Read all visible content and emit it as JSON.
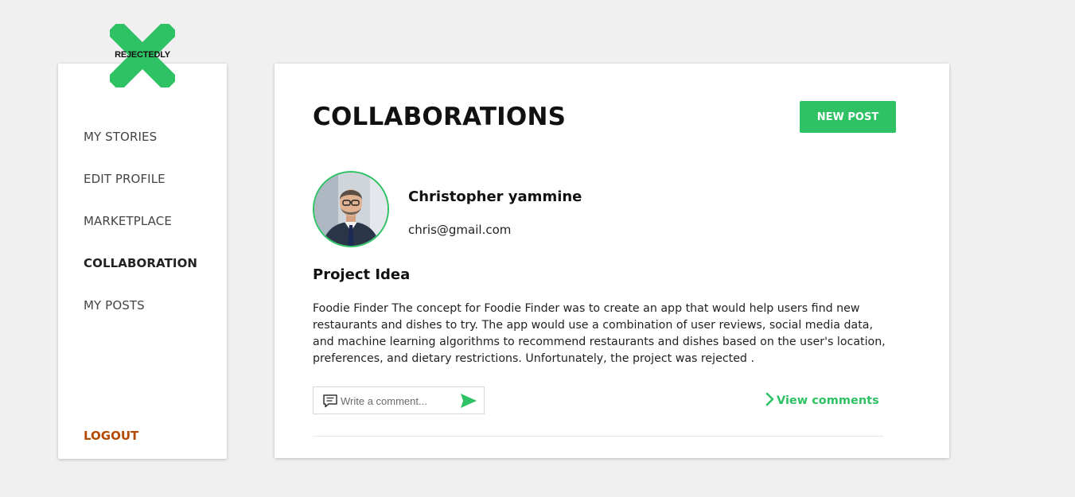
{
  "brand": {
    "name": "REJECTEDLY",
    "accent_color": "#2ec264"
  },
  "sidebar": {
    "items": [
      {
        "label": "MY STORIES",
        "active": false
      },
      {
        "label": "EDIT PROFILE",
        "active": false
      },
      {
        "label": "MARKETPLACE",
        "active": false
      },
      {
        "label": "COLLABORATION",
        "active": true
      },
      {
        "label": "MY POSTS",
        "active": false
      }
    ],
    "logout_label": "LOGOUT",
    "logout_color": "#b34a00"
  },
  "main": {
    "title": "COLLABORATIONS",
    "new_post_label": "NEW POST",
    "post": {
      "author_name": "Christopher yammine",
      "author_email": "chris@gmail.com",
      "title": "Project Idea",
      "body": "Foodie Finder The concept for Foodie Finder was to create an app that would help users find new restaurants and dishes to try. The app would use a combination of user reviews, social media data, and machine learning algorithms to recommend restaurants and dishes based on the user's location, preferences, and dietary restrictions. Unfortunately, the project was rejected .",
      "comment_placeholder": "Write a comment...",
      "view_comments_label": "View comments"
    }
  },
  "icons": {
    "logo": "x-mark-logo-icon",
    "avatar": "user-avatar",
    "comment": "comment-icon",
    "send": "send-icon",
    "chevron": "chevron-right-icon"
  }
}
